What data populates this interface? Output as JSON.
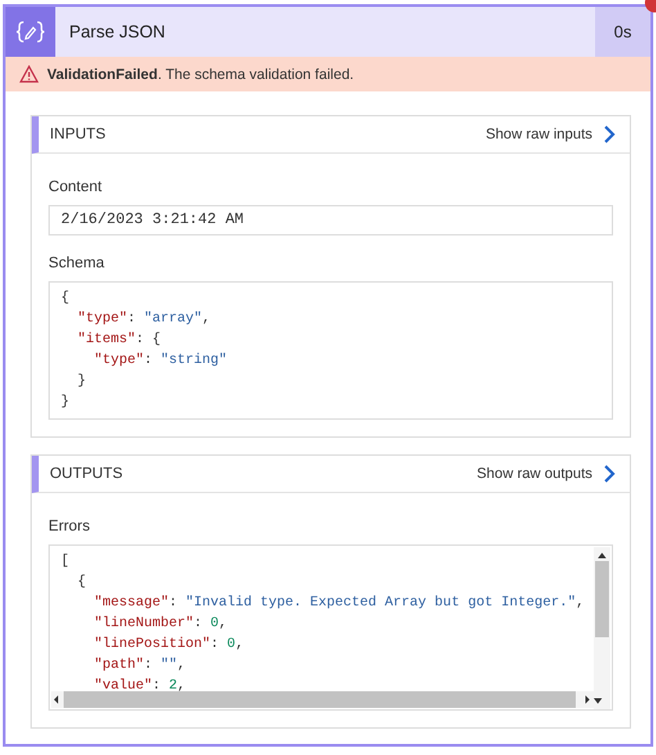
{
  "action": {
    "title": "Parse JSON",
    "duration": "0s",
    "failed": true
  },
  "error": {
    "code": "ValidationFailed",
    "message": ". The schema validation failed."
  },
  "panels": [
    {
      "title": "INPUTS",
      "link": "Show raw inputs",
      "fields": [
        {
          "label": "Content",
          "kind": "text",
          "value": "2/16/2023 3:21:42 AM"
        },
        {
          "label": "Schema",
          "kind": "code",
          "lines": [
            [
              {
                "kind": "punct",
                "text": "{"
              }
            ],
            [
              {
                "kind": "key",
                "text": "  \"type\""
              },
              {
                "kind": "punct",
                "text": ": "
              },
              {
                "kind": "string",
                "text": "\"array\""
              },
              {
                "kind": "punct",
                "text": ","
              }
            ],
            [
              {
                "kind": "key",
                "text": "  \"items\""
              },
              {
                "kind": "punct",
                "text": ": {"
              }
            ],
            [
              {
                "kind": "key",
                "text": "    \"type\""
              },
              {
                "kind": "punct",
                "text": ": "
              },
              {
                "kind": "string",
                "text": "\"string\""
              }
            ],
            [
              {
                "kind": "punct",
                "text": "  }"
              }
            ],
            [
              {
                "kind": "punct",
                "text": "}"
              }
            ]
          ]
        }
      ]
    },
    {
      "title": "OUTPUTS",
      "link": "Show raw outputs",
      "fields": [
        {
          "label": "Errors",
          "kind": "code",
          "scrollable": true,
          "lines": [
            [
              {
                "kind": "punct",
                "text": "["
              }
            ],
            [
              {
                "kind": "punct",
                "text": "  {"
              }
            ],
            [
              {
                "kind": "key",
                "text": "    \"message\""
              },
              {
                "kind": "punct",
                "text": ": "
              },
              {
                "kind": "string",
                "text": "\"Invalid type. Expected Array but got Integer.\""
              },
              {
                "kind": "punct",
                "text": ","
              }
            ],
            [
              {
                "kind": "key",
                "text": "    \"lineNumber\""
              },
              {
                "kind": "punct",
                "text": ": "
              },
              {
                "kind": "number",
                "text": "0"
              },
              {
                "kind": "punct",
                "text": ","
              }
            ],
            [
              {
                "kind": "key",
                "text": "    \"linePosition\""
              },
              {
                "kind": "punct",
                "text": ": "
              },
              {
                "kind": "number",
                "text": "0"
              },
              {
                "kind": "punct",
                "text": ","
              }
            ],
            [
              {
                "kind": "key",
                "text": "    \"path\""
              },
              {
                "kind": "punct",
                "text": ": "
              },
              {
                "kind": "string",
                "text": "\"\""
              },
              {
                "kind": "punct",
                "text": ","
              }
            ],
            [
              {
                "kind": "key",
                "text": "    \"value\""
              },
              {
                "kind": "punct",
                "text": ": "
              },
              {
                "kind": "number",
                "text": "2"
              },
              {
                "kind": "punct",
                "text": ","
              }
            ]
          ]
        }
      ]
    }
  ]
}
